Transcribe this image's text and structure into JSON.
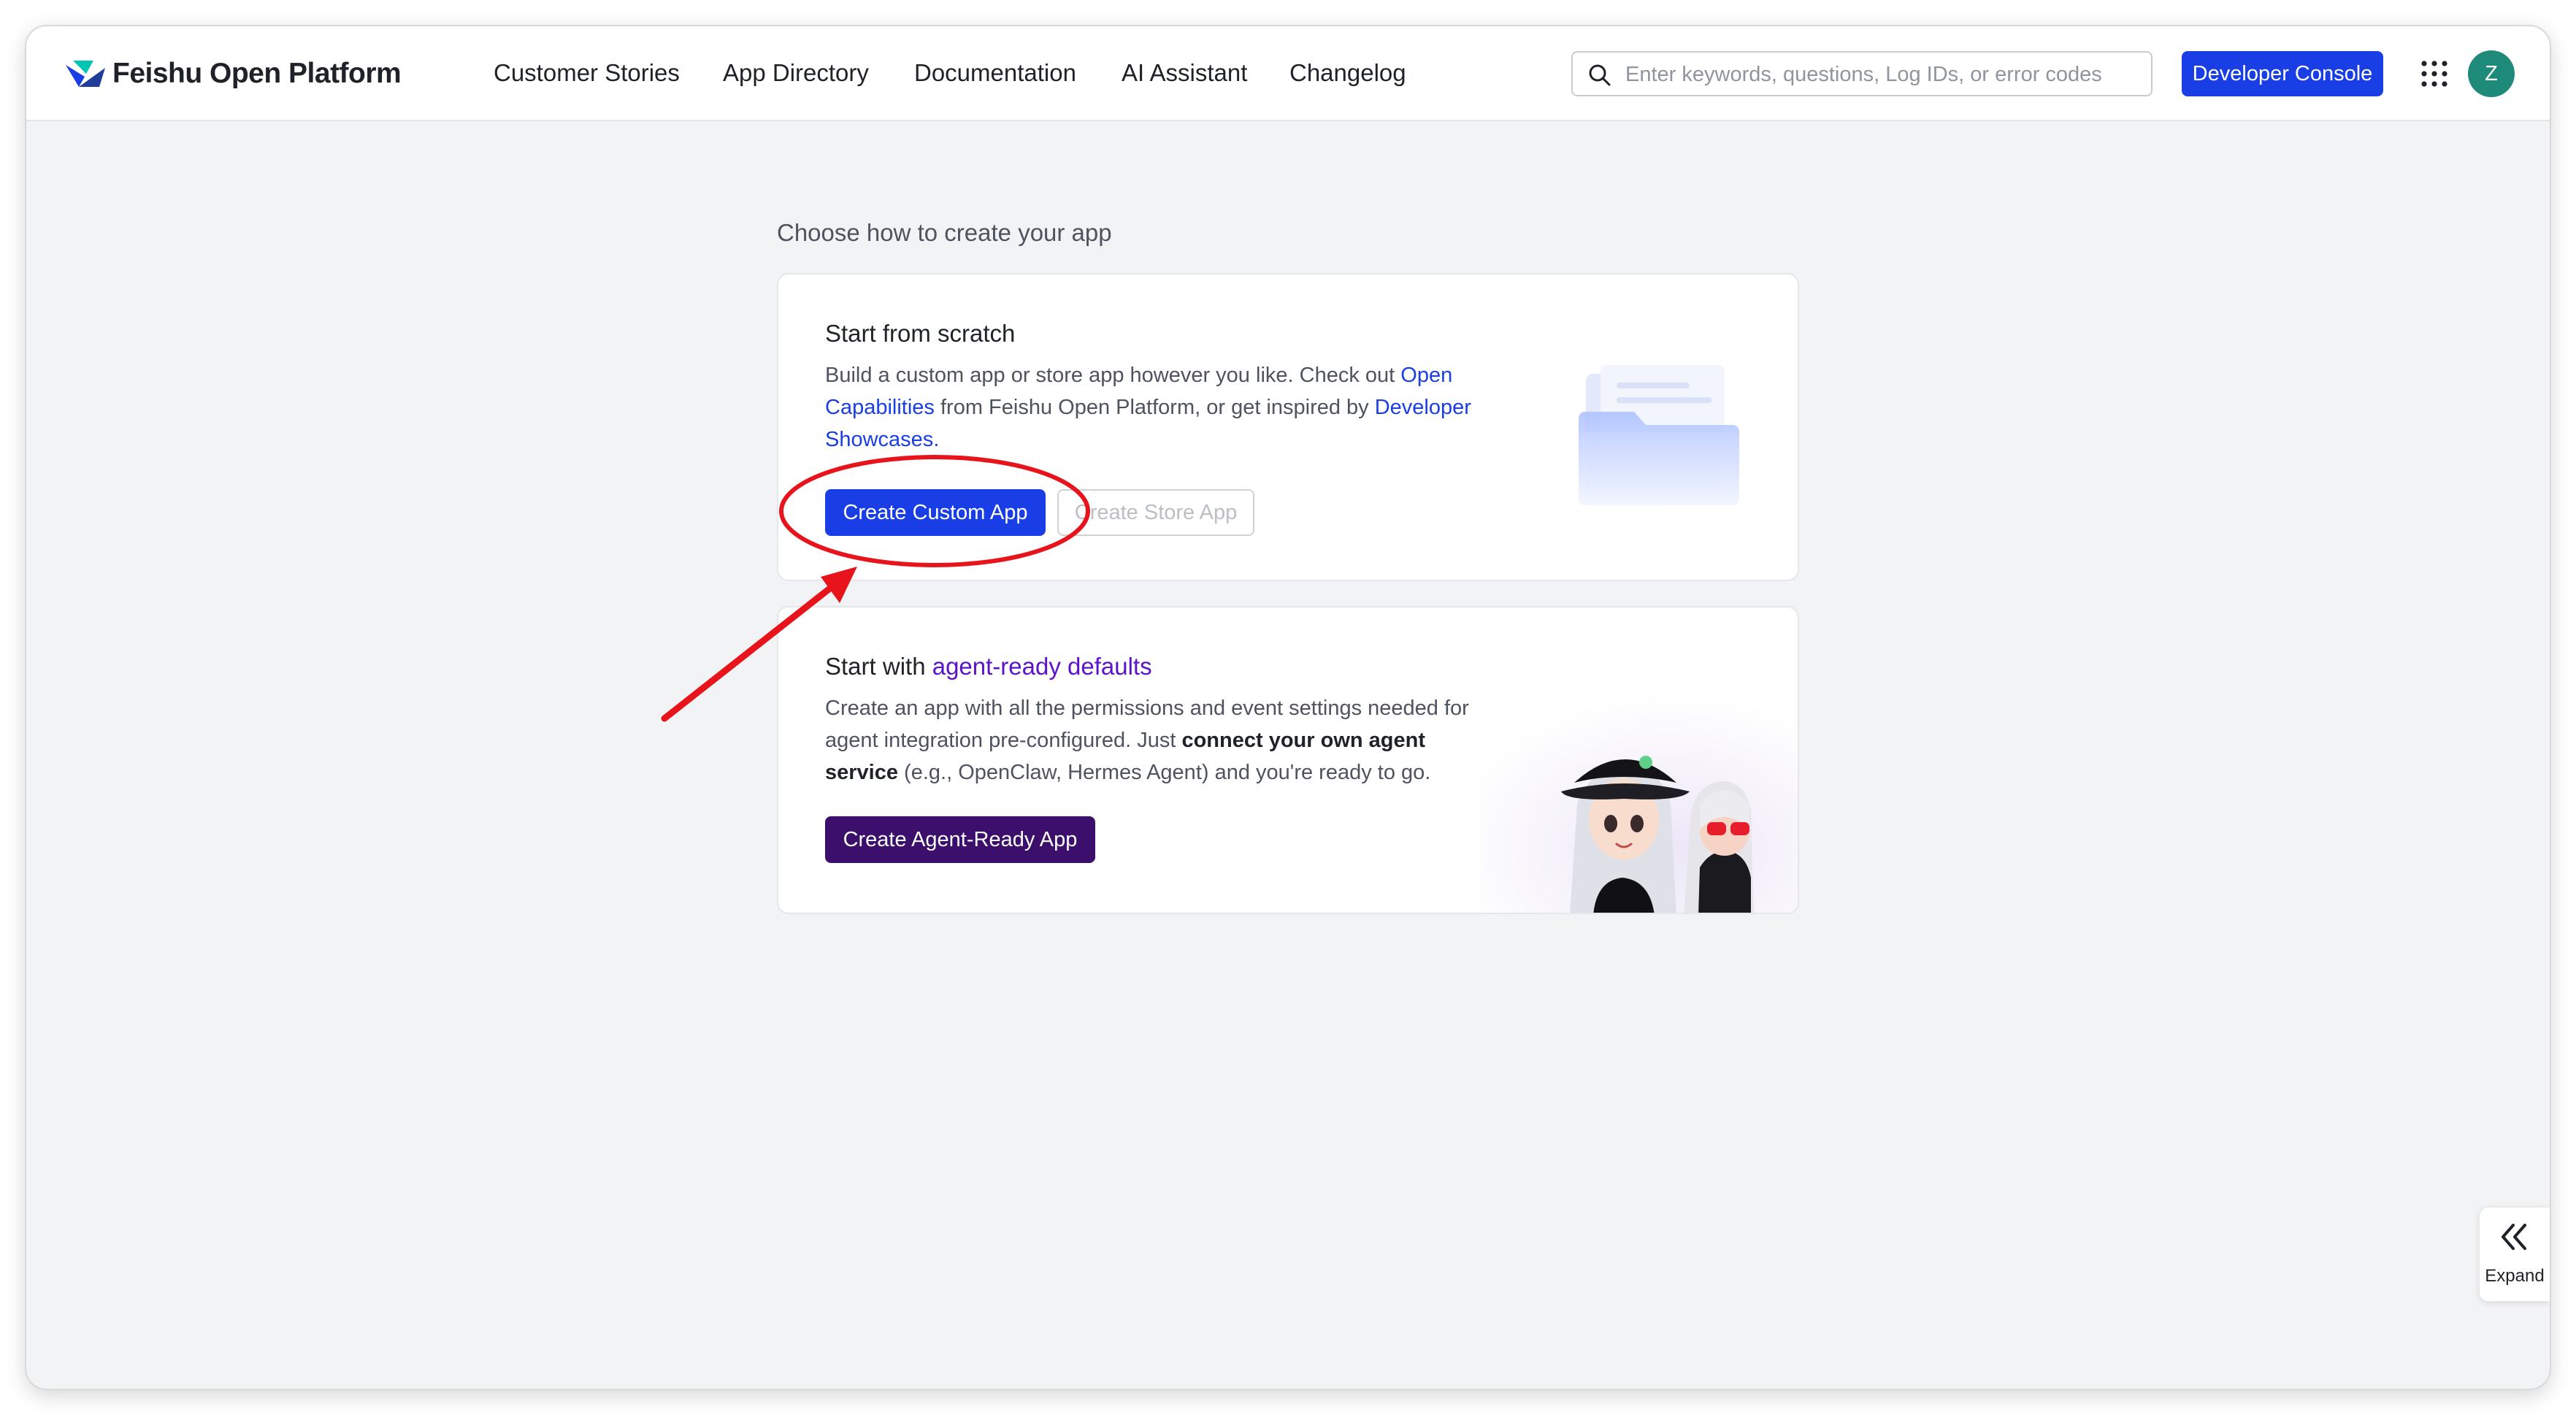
{
  "header": {
    "brand": "Feishu Open Platform",
    "nav": [
      "Customer Stories",
      "App Directory",
      "Documentation",
      "AI Assistant",
      "Changelog"
    ],
    "search_placeholder": "Enter keywords, questions, Log IDs, or error codes",
    "developer_console": "Developer Console",
    "avatar_initial": "Z"
  },
  "main": {
    "heading": "Choose how to create your app",
    "scratch": {
      "title": "Start from scratch",
      "desc_1": "Build a custom app or store app however you like. Check out ",
      "desc_link_1": "Open Capabilities",
      "desc_2": " from Feishu Open Platform, or get inspired by ",
      "desc_link_2": "Developer Showcases",
      "desc_3": ".",
      "btn_custom": "Create Custom App",
      "btn_store": "Create Store App"
    },
    "agent": {
      "title_prefix": "Start with ",
      "title_highlight": "agent-ready defaults",
      "desc_1": "Create an app with all the permissions and event settings needed for agent integration pre-configured. Just ",
      "desc_bold": "connect your own agent service",
      "desc_2": " (e.g., OpenClaw, Hermes Agent) and you're ready to go.",
      "btn": "Create Agent-Ready App"
    }
  },
  "expand_label": "Expand",
  "colors": {
    "brand_blue": "#1a3ee6",
    "agent_purple": "#3b0f6b",
    "highlight_purple": "#5b13c9",
    "annotation_red": "#e8141c"
  },
  "icons": [
    "feishu-logo-icon",
    "search-icon",
    "apps-grid-icon",
    "folder-illustration",
    "agent-characters-illustration",
    "double-chevron-left-icon"
  ]
}
